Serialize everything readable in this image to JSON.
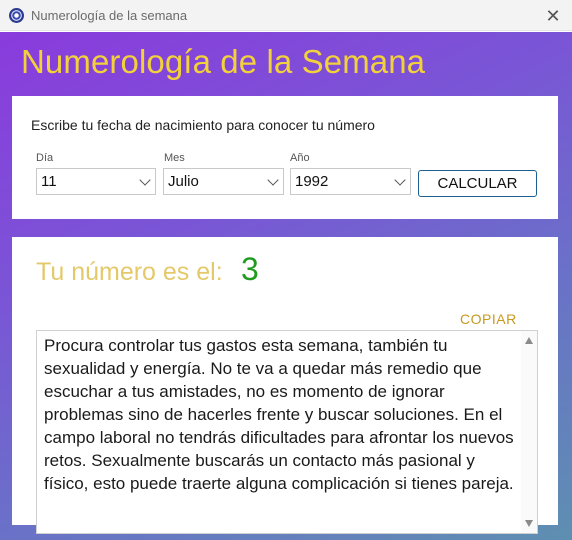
{
  "window": {
    "title": "Numerología de la semana",
    "close_label": "✕"
  },
  "header": {
    "title": "Numerología de la Semana",
    "title_color": "#f2d13b"
  },
  "form": {
    "prompt": "Escribe tu fecha de nacimiento para conocer tu número",
    "day": {
      "label": "Día",
      "value": "11"
    },
    "month": {
      "label": "Mes",
      "value": "Julio"
    },
    "year": {
      "label": "Año",
      "value": "1992"
    },
    "calculate_label": "CALCULAR"
  },
  "result": {
    "label": "Tu número es el:",
    "number": "3",
    "number_color": "#1f9c1f",
    "copy_label": "COPIAR",
    "text": "Procura controlar tus gastos esta semana, también tu sexualidad y energía. No te va a quedar más remedio que escuchar a tus amistades, no es momento de ignorar problemas sino de hacerles frente y buscar soluciones. En el campo laboral no tendrás dificultades para afrontar los nuevos retos. Sexualmente buscarás un contacto más pasional y físico, esto puede traerte alguna complicación si tienes pareja."
  },
  "icons": {
    "app": "numerology-app-icon",
    "close": "close-icon",
    "dropdown": "chevron-down-icon",
    "scroll_up": "scroll-up-arrow-icon",
    "scroll_down": "scroll-down-arrow-icon"
  }
}
